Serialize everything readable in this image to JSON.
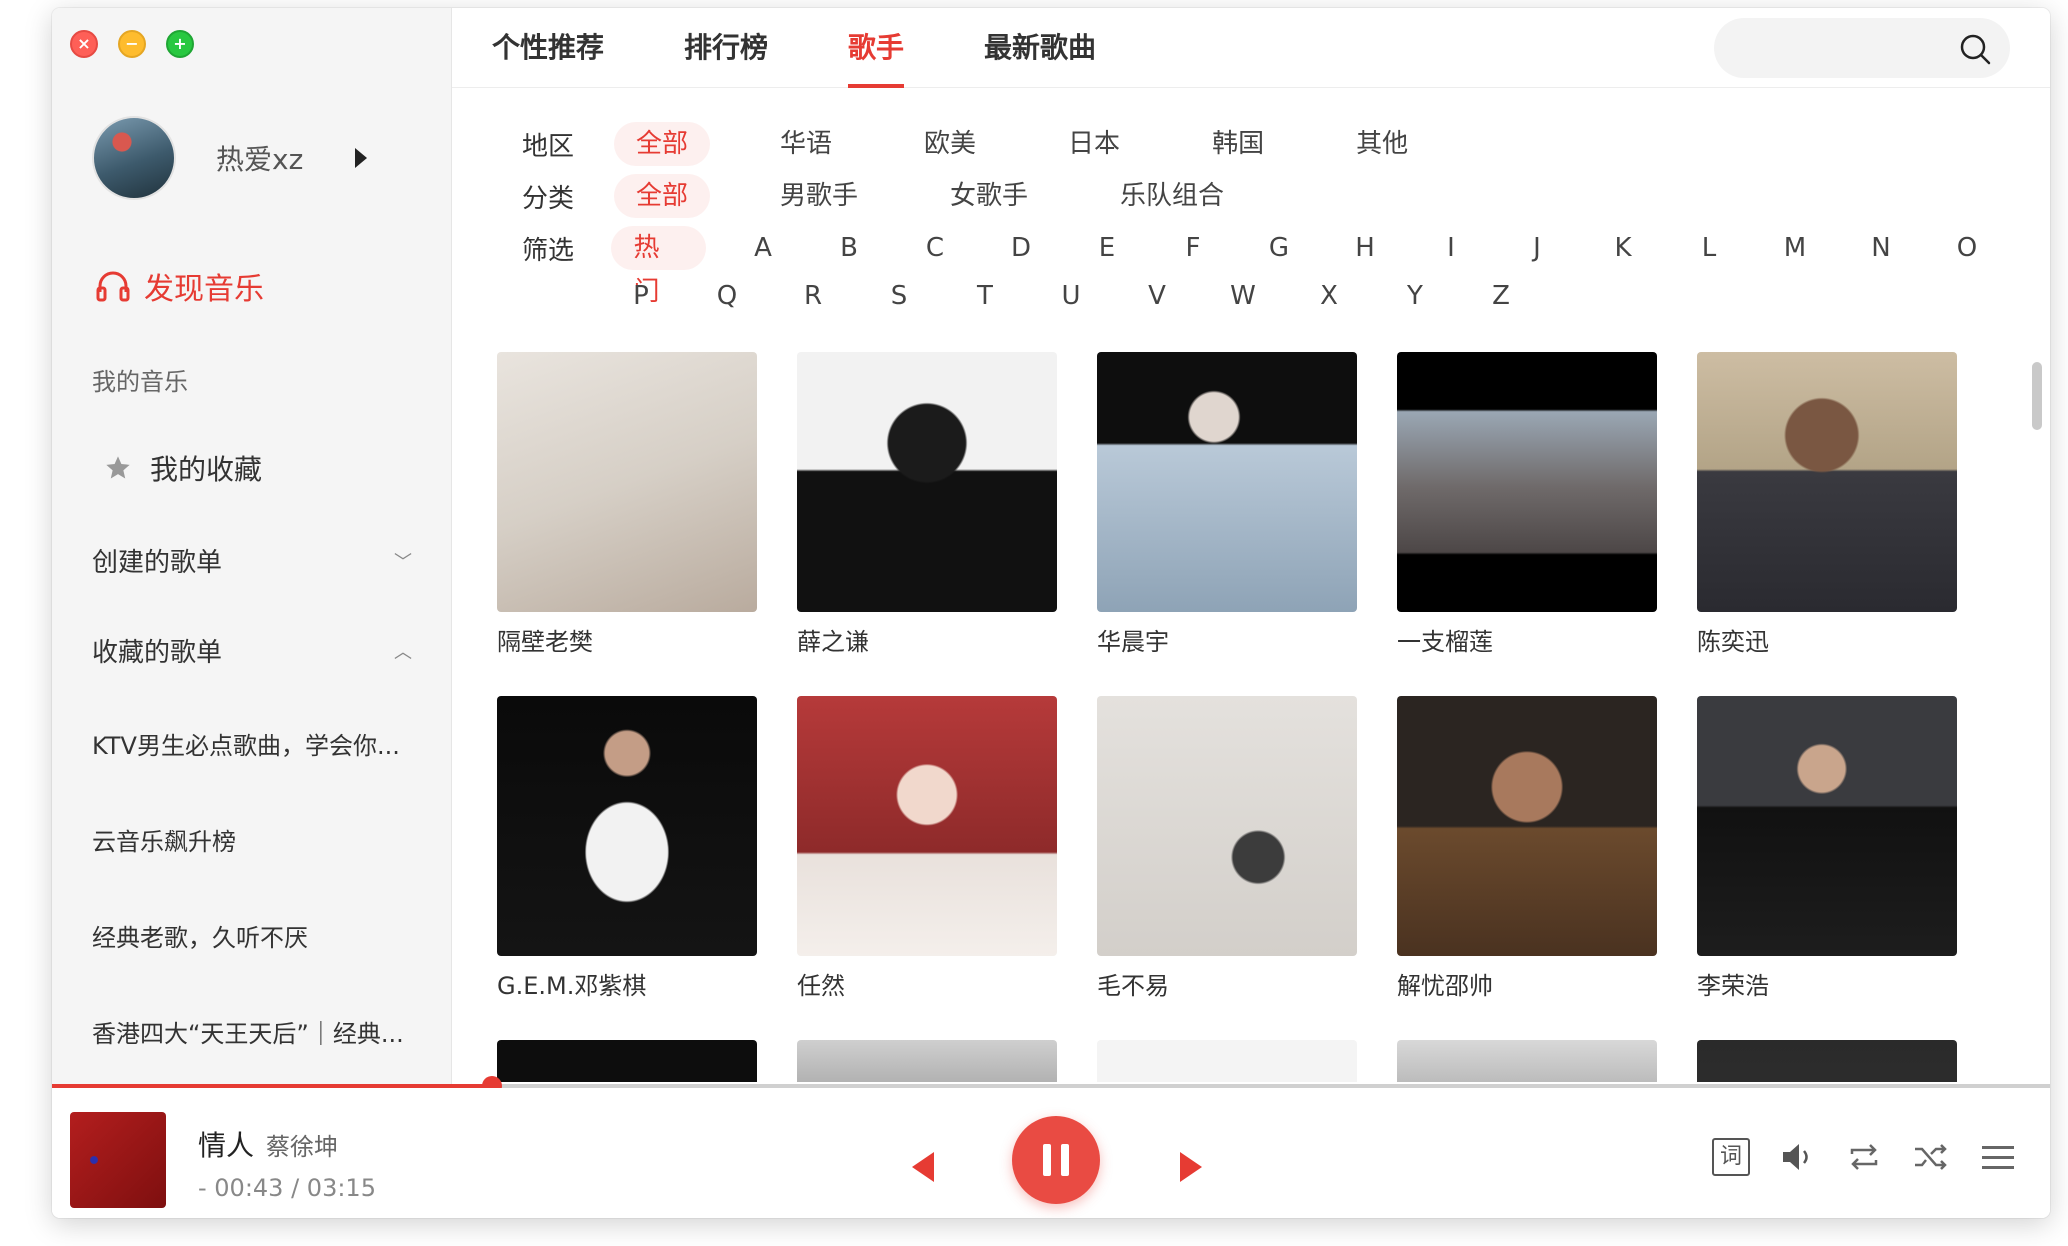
{
  "sidebar": {
    "user_name": "热爱xz",
    "discover": "发现音乐",
    "my_music_label": "我的音乐",
    "favorites": "我的收藏",
    "created_playlists": "创建的歌单",
    "collected_playlists": "收藏的歌单",
    "playlists": [
      "KTV男生必点歌曲，学会你...",
      "云音乐飙升榜",
      "经典老歌，久听不厌",
      "香港四大“天王天后”｜经典..."
    ]
  },
  "tabs": [
    "个性推荐",
    "排行榜",
    "歌手",
    "最新歌曲"
  ],
  "active_tab": "歌手",
  "filters": {
    "region": {
      "label": "地区",
      "options": [
        "全部",
        "华语",
        "欧美",
        "日本",
        "韩国",
        "其他"
      ]
    },
    "category": {
      "label": "分类",
      "options": [
        "全部",
        "男歌手",
        "女歌手",
        "乐队组合"
      ]
    },
    "filter": {
      "label": "筛选",
      "hot": "热门",
      "letters_row1": [
        "A",
        "B",
        "C",
        "D",
        "E",
        "F",
        "G",
        "H",
        "I",
        "J",
        "K",
        "L",
        "M",
        "N",
        "O"
      ],
      "letters_row2": [
        "P",
        "Q",
        "R",
        "S",
        "T",
        "U",
        "V",
        "W",
        "X",
        "Y",
        "Z"
      ]
    }
  },
  "artists": [
    "隔壁老樊",
    "薛之谦",
    "华晨宇",
    "一支榴莲",
    "陈奕迅",
    "G.E.M.邓紫棋",
    "任然",
    "毛不易",
    "解忧邵帅",
    "李荣浩"
  ],
  "player": {
    "title": "情人",
    "artist": "蔡徐坤",
    "time": "- 00:43 / 03:15",
    "progress_percent": 22,
    "lyric_label": "词"
  },
  "colors": {
    "accent": "#e63b33"
  }
}
